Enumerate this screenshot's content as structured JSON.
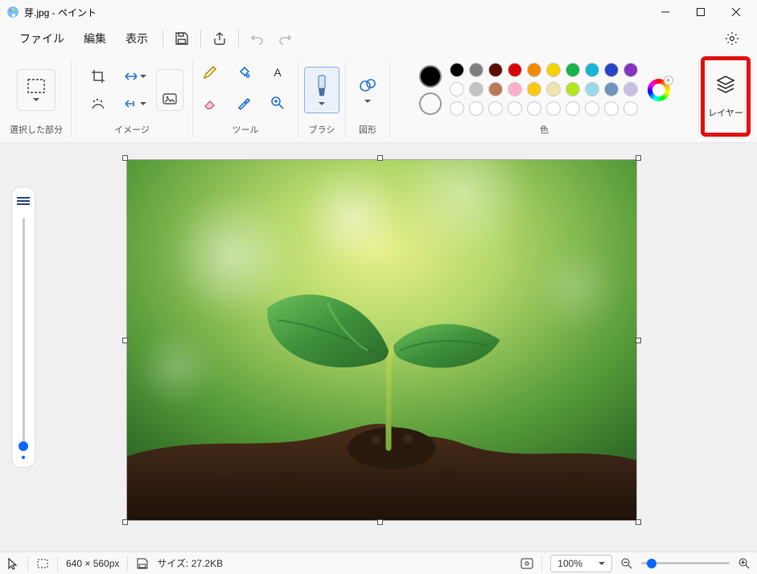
{
  "window": {
    "title": "芽.jpg - ペイント"
  },
  "menus": {
    "file": "ファイル",
    "edit": "編集",
    "view": "表示"
  },
  "ribbon": {
    "selection_label": "選択した部分",
    "image_label": "イメージ",
    "tools_label": "ツール",
    "brush_label": "ブラシ",
    "shapes_label": "図形",
    "colors_label": "色",
    "layers_label": "レイヤー"
  },
  "colors": {
    "row1": [
      "#000000",
      "#7f7f7f",
      "#5b0f00",
      "#d90000",
      "#f38a00",
      "#f3d300",
      "#18b24a",
      "#17b3d3",
      "#2845c8",
      "#8434c2"
    ],
    "row2": [
      "#ffffff",
      "#c3c3c3",
      "#b97a57",
      "#ffaec9",
      "#ffc90e",
      "#efe4b0",
      "#b5e61d",
      "#99d9ea",
      "#7092be",
      "#c8bfe7"
    ]
  },
  "status": {
    "dimensions": "640 × 560px",
    "size_label": "サイズ:",
    "size_value": "27.2KB",
    "zoom_value": "100%"
  }
}
